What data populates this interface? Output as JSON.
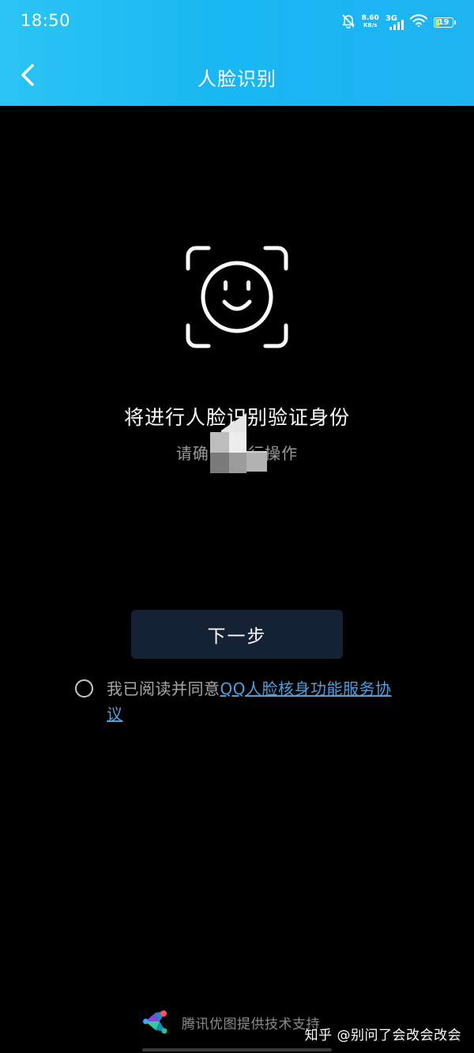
{
  "status_bar": {
    "time": "18:50",
    "net_speed_value": "8.60",
    "net_speed_unit": "KB/s",
    "network_type": "3G",
    "battery_level": "19",
    "icons": [
      "mute-bell-icon",
      "signal-icon",
      "wifi-icon",
      "battery-icon"
    ]
  },
  "header": {
    "title": "人脸识别",
    "back_icon": "chevron-left-icon"
  },
  "main": {
    "face_icon": "face-scan-icon",
    "title": "将进行人脸识别验证身份",
    "subtitle": "请确认是          行操作"
  },
  "actions": {
    "next_label": "下一步"
  },
  "agreement": {
    "prefix": "我已阅读并同意",
    "link_text": "QQ人脸核身功能服务协议",
    "checked": false
  },
  "footer": {
    "logo_icon": "youtu-logo-icon",
    "text": "腾讯优图提供技术支持"
  },
  "watermark": "知乎 @别问了会改会改会",
  "colors": {
    "header_gradient_start": "#2bc4f4",
    "header_gradient_end": "#1fb3f1",
    "background": "#000000",
    "button_bg": "#152235",
    "link": "#4f9fdc"
  }
}
